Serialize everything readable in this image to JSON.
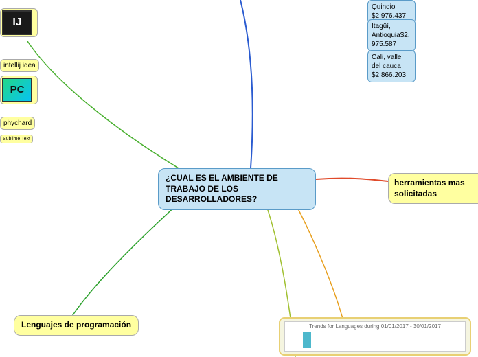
{
  "central": {
    "title": "¿CUAL ES EL AMBIENTE DE TRABAJO DE LOS DESARROLLADORES?"
  },
  "right": {
    "herramientas": "herramientas mas solicitadas"
  },
  "left": {
    "lenguajes": "Lenguajes de programación"
  },
  "tools": {
    "intellij": "intellij idea",
    "phychart": "phychard",
    "sublime": "Sublime Text"
  },
  "salaries": {
    "quindio": "Quindio $2.976.437",
    "itagui": "Itagüí, Antioquia$2.975.587",
    "cali": "Cali, valle del cauca $2.866.203"
  },
  "chart": {
    "title": "Trends for Languages during 01/01/2017 - 30/01/2017"
  },
  "icons": {
    "ij": "IJ",
    "pc": "PC"
  }
}
